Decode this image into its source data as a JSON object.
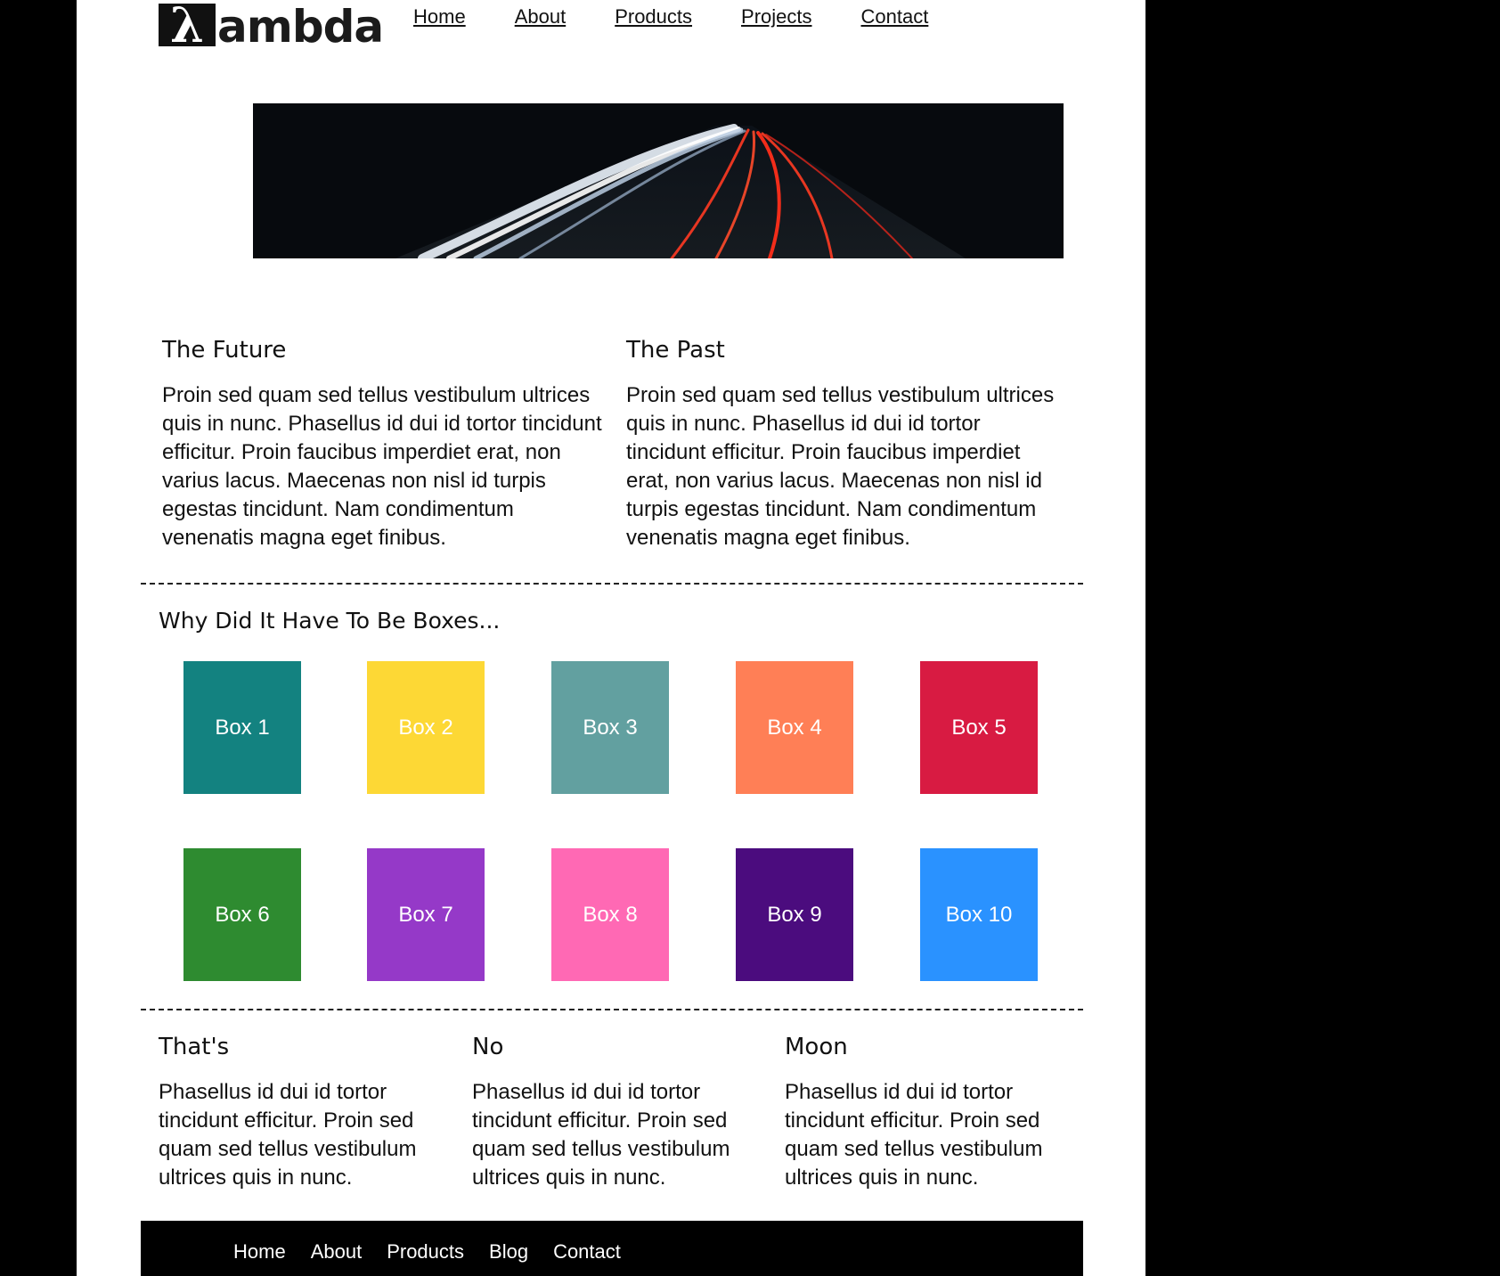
{
  "header": {
    "logo_mark": "λ",
    "logo_text": "ambda",
    "nav": [
      "Home",
      "About",
      "Products",
      "Projects",
      "Contact"
    ]
  },
  "intro": [
    {
      "title": "The Future",
      "text": "Proin sed quam sed tellus vestibulum ultrices quis in nunc. Phasellus id dui id tortor tincidunt efficitur. Proin faucibus imperdiet erat, non varius lacus. Maecenas non nisl id turpis egestas tincidunt. Nam condimentum venenatis magna eget finibus."
    },
    {
      "title": "The Past",
      "text": "Proin sed quam sed tellus vestibulum ultrices quis in nunc. Phasellus id dui id tortor tincidunt efficitur. Proin faucibus imperdiet erat, non varius lacus. Maecenas non nisl id turpis egestas tincidunt. Nam condimentum venenatis magna eget finibus."
    }
  ],
  "boxes_section": {
    "title": "Why Did It Have To Be Boxes...",
    "boxes": [
      {
        "label": "Box 1",
        "color": "#138280"
      },
      {
        "label": "Box 2",
        "color": "#fdd835"
      },
      {
        "label": "Box 3",
        "color": "#62a0a0"
      },
      {
        "label": "Box 4",
        "color": "#ff7f56"
      },
      {
        "label": "Box 5",
        "color": "#d81b42"
      },
      {
        "label": "Box 6",
        "color": "#2e8b30"
      },
      {
        "label": "Box 7",
        "color": "#9539c8"
      },
      {
        "label": "Box 8",
        "color": "#ff69b4"
      },
      {
        "label": "Box 9",
        "color": "#4b0c7e"
      },
      {
        "label": "Box 10",
        "color": "#2a92ff"
      }
    ]
  },
  "columns": [
    {
      "title": "That's",
      "text": "Phasellus id dui id tortor tincidunt efficitur. Proin sed quam sed tellus vestibulum ultrices quis in nunc."
    },
    {
      "title": "No",
      "text": "Phasellus id dui id tortor tincidunt efficitur. Proin sed quam sed tellus vestibulum ultrices quis in nunc."
    },
    {
      "title": "Moon",
      "text": "Phasellus id dui id tortor tincidunt efficitur. Proin sed quam sed tellus vestibulum ultrices quis in nunc."
    }
  ],
  "footer": {
    "nav": [
      "Home",
      "About",
      "Products",
      "Blog",
      "Contact"
    ]
  }
}
